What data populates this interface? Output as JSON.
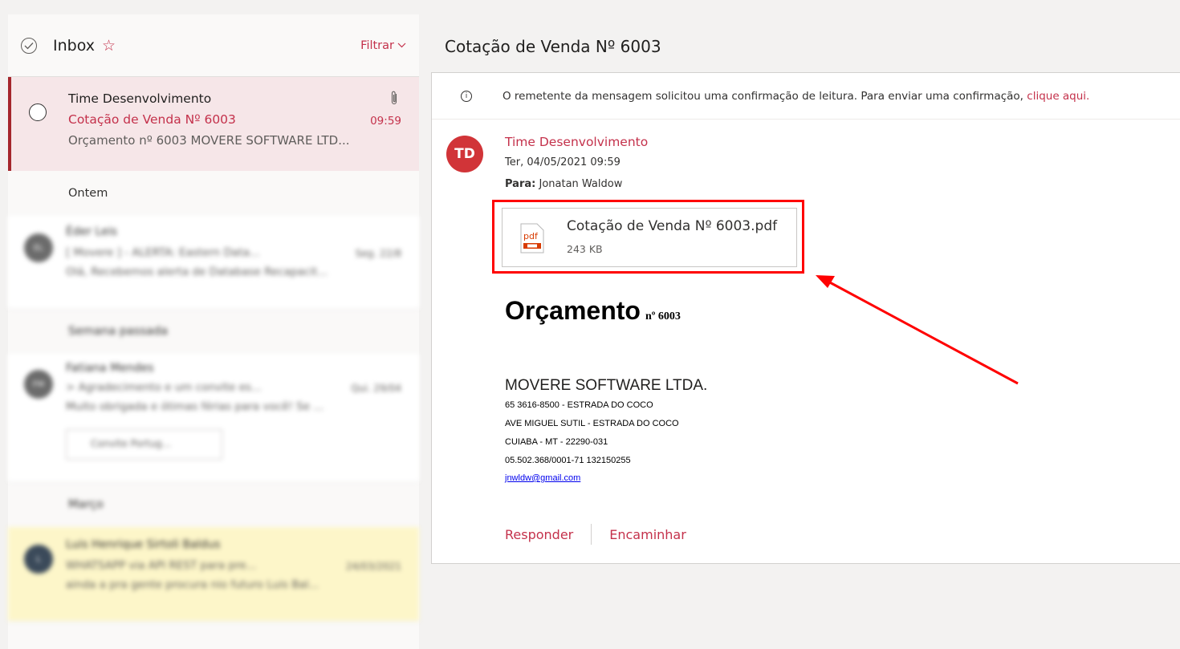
{
  "list": {
    "title": "Inbox",
    "filter_label": "Filtrar",
    "active": {
      "sender": "Time Desenvolvimento",
      "subject": "Cotação de Venda Nº 6003",
      "time": "09:59",
      "preview": "Orçamento nº 6003 MOVERE SOFTWARE LTD..."
    },
    "groups": [
      "Ontem",
      "Semana passada",
      "Março"
    ],
    "blurred": [
      {
        "avatar": "EL",
        "sender": "Éder Leis",
        "subject": "[ Movere ] - ALERTA: Eastern Data...",
        "date": "Seg. 22/8",
        "preview": "Olá, Recebemos alerta de Database Recapacit..."
      },
      {
        "avatar": "FM",
        "sender": "Fatiana Mendes",
        "subject": "> Agradecimento e um convite es...",
        "date": "Qui. 29/04",
        "preview": "Muito obrigada e ótimas férias para você! Se ...",
        "attachment": "Convite Portug..."
      },
      {
        "avatar": "L",
        "sender": "Luis Henrique Sirtoli Baldus",
        "subject": "WHATSAPP via API REST para pre...",
        "date": "24/03/2021",
        "preview": "ainda a pra gente procura nio futuro Luis Bal..."
      }
    ]
  },
  "reading": {
    "subject": "Cotação de Venda Nº 6003",
    "receipt_text": "O remetente da mensagem solicitou uma confirmação de leitura. Para enviar uma confirmação, ",
    "receipt_link": "clique aqui.",
    "avatar_initials": "TD",
    "from": "Time Desenvolvimento",
    "date": "Ter, 04/05/2021 09:59",
    "to_label": "Para:",
    "to_name": "Jonatan Waldow",
    "attachment": {
      "name": "Cotação de Venda Nº 6003.pdf",
      "size": "243 KB",
      "icon": "pdf-icon"
    },
    "body": {
      "heading": "Orçamento",
      "heading_number": "nº 6003",
      "company": "MOVERE SOFTWARE LTDA.",
      "lines": [
        "65 3616-8500 - ESTRADA DO COCO",
        "AVE MIGUEL SUTIL - ESTRADA DO COCO",
        "CUIABA - MT - 22290-031",
        "05.502.368/0001-71  132150255"
      ],
      "email": "jnwldw@gmail.com"
    },
    "reply_label": "Responder",
    "forward_label": "Encaminhar"
  },
  "colors": {
    "accent": "#c4314b",
    "highlight": "#ff0000",
    "avatar": "#d13438"
  }
}
